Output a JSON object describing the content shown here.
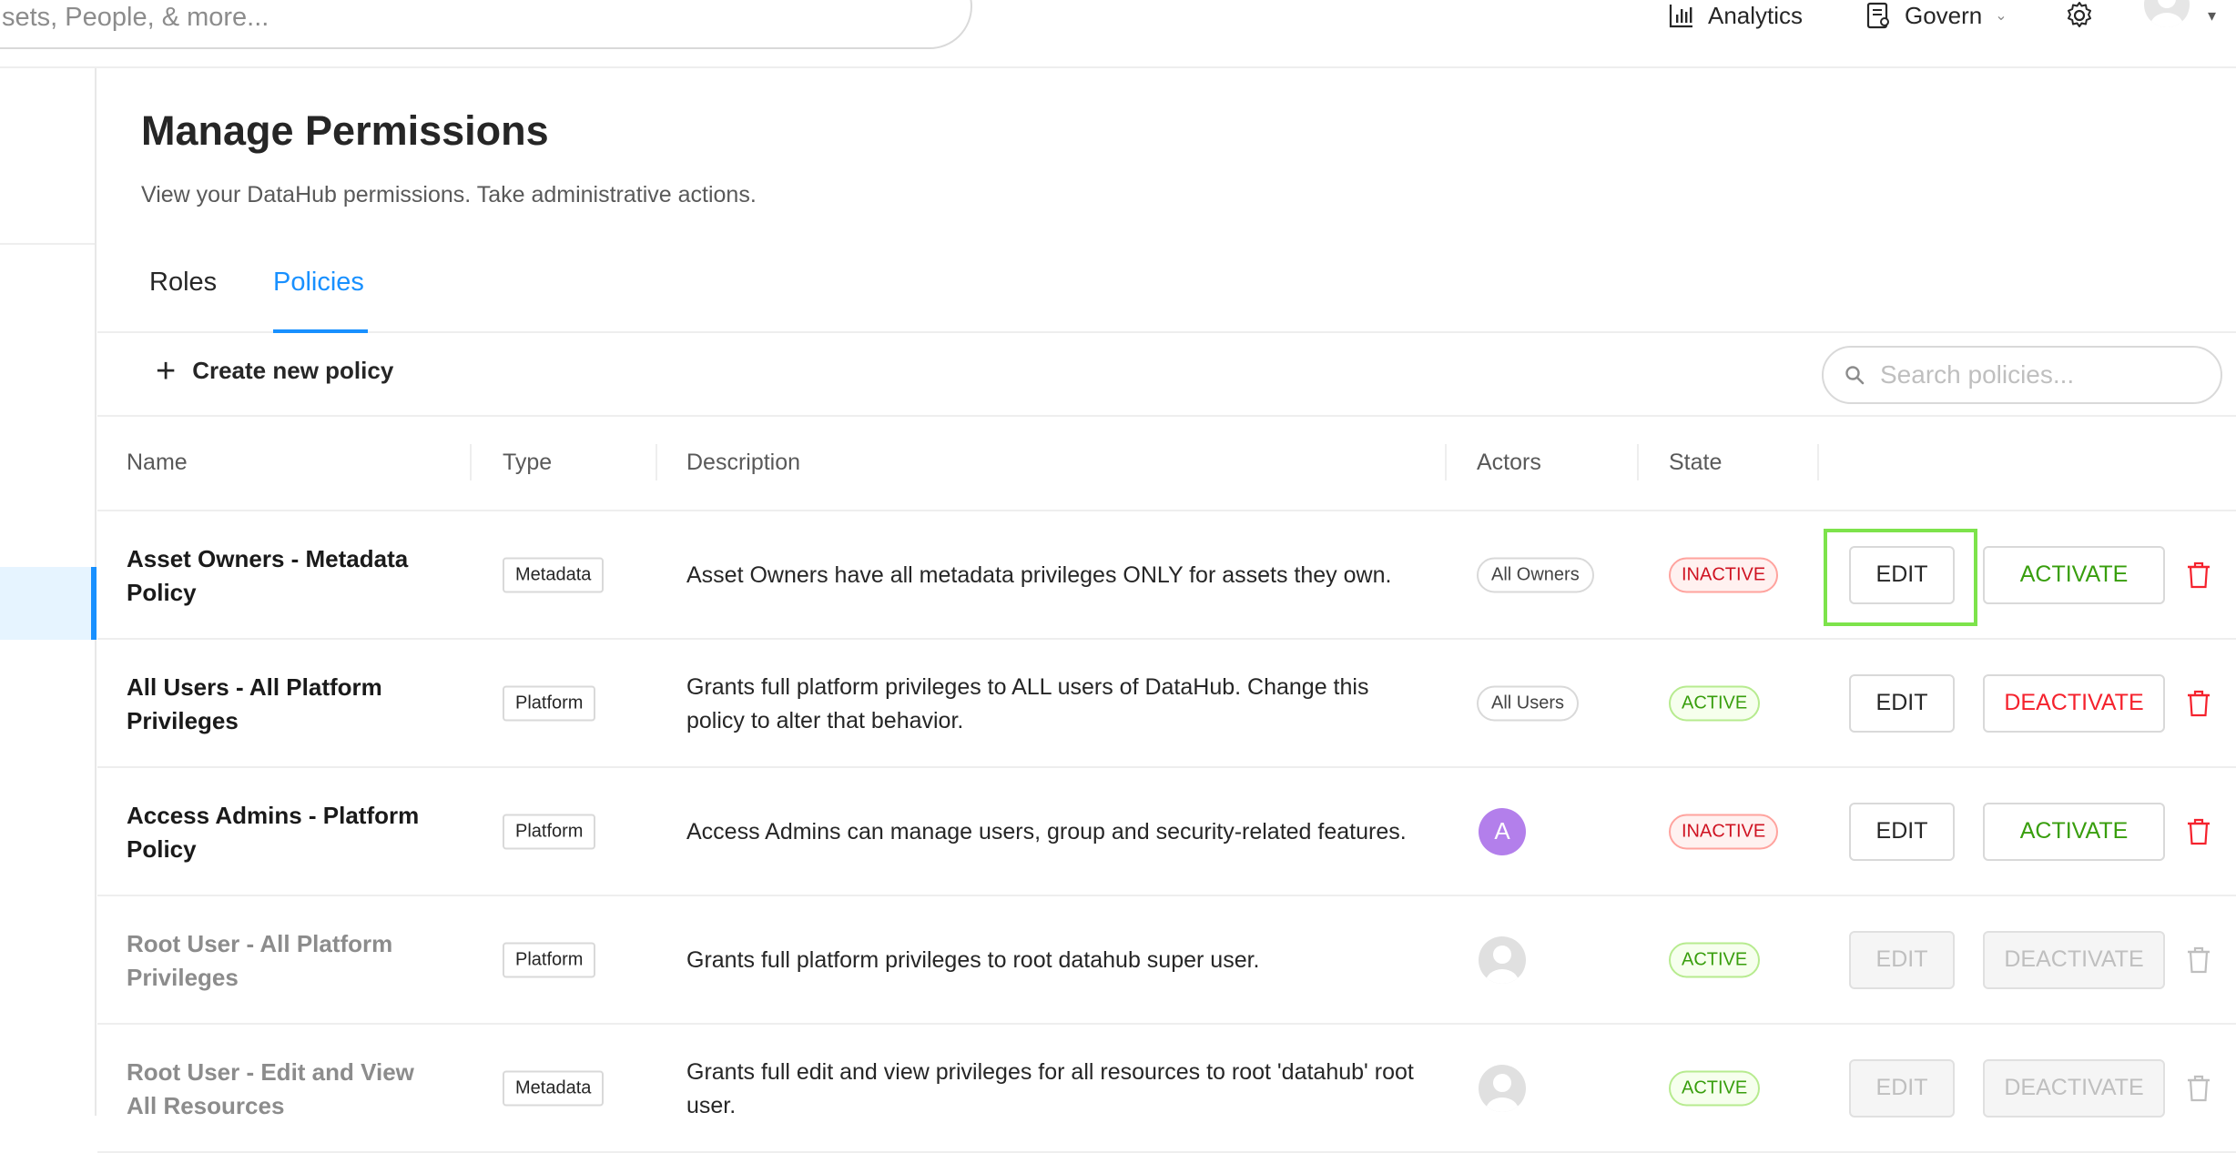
{
  "header": {
    "search_placeholder": "sets, People, & more...",
    "nav": {
      "analytics": "Analytics",
      "govern": "Govern"
    }
  },
  "page": {
    "title": "Manage Permissions",
    "subtitle": "View your DataHub permissions. Take administrative actions."
  },
  "tabs": [
    {
      "label": "Roles",
      "active": false
    },
    {
      "label": "Policies",
      "active": true
    }
  ],
  "toolbar": {
    "create_label": "Create new policy",
    "search_placeholder": "Search policies..."
  },
  "table": {
    "columns": [
      "Name",
      "Type",
      "Description",
      "Actors",
      "State"
    ],
    "rows": [
      {
        "name": "Asset Owners - Metadata Policy",
        "type": "Metadata",
        "description": "Asset Owners have all metadata privileges ONLY for assets they own.",
        "actor": "All Owners",
        "state": "INACTIVE",
        "edit_label": "EDIT",
        "toggle_label": "ACTIVATE"
      },
      {
        "name": "All Users - All Platform Privileges",
        "type": "Platform",
        "description": "Grants full platform privileges to ALL users of DataHub. Change this policy to alter that behavior.",
        "actor": "All Users",
        "state": "ACTIVE",
        "edit_label": "EDIT",
        "toggle_label": "DEACTIVATE"
      },
      {
        "name": "Access Admins - Platform Policy",
        "type": "Platform",
        "description": "Access Admins can manage users, group and security-related features.",
        "actor": "A",
        "state": "INACTIVE",
        "edit_label": "EDIT",
        "toggle_label": "ACTIVATE"
      },
      {
        "name": "Root User - All Platform Privileges",
        "type": "Platform",
        "description": "Grants full platform privileges to root datahub super user.",
        "actor": "",
        "state": "ACTIVE",
        "edit_label": "EDIT",
        "toggle_label": "DEACTIVATE"
      },
      {
        "name": "Root User - Edit and View All Resources",
        "type": "Metadata",
        "description": "Grants full edit and view privileges for all resources to root 'datahub' root user.",
        "actor": "",
        "state": "ACTIVE",
        "edit_label": "EDIT",
        "toggle_label": "DEACTIVATE"
      }
    ]
  },
  "colors": {
    "accent": "#1890ff",
    "active": "#389e0d",
    "inactive": "#cf1322",
    "danger": "#f5222d",
    "avatar_letter": "#b37feb",
    "highlight": "#7de34b"
  },
  "icons": {
    "analytics": "bar-chart-icon",
    "govern": "document-icon",
    "settings": "gear-icon",
    "search": "search-icon",
    "create": "plus-icon",
    "delete": "trash-icon"
  }
}
